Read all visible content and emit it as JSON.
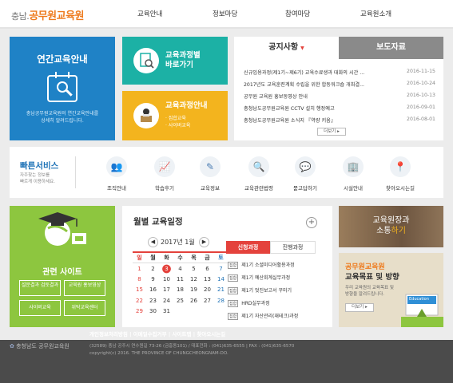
{
  "header": {
    "logo_prefix": "충남.",
    "logo_main": "공무원교육원",
    "nav": [
      "교육안내",
      "정보마당",
      "참여마당",
      "교육원소개"
    ]
  },
  "tiles": {
    "annual_title": "연간교육안내",
    "annual_desc1": "충남공무원교육원의 연간교육안내를",
    "annual_desc2": "상세히 알려드립니다.",
    "course_title1": "교육과정별",
    "course_title2": "바로가기",
    "guide_title": "교육과정안내",
    "guide_sub1": "· 집합교육",
    "guide_sub2": "· 사이버교육"
  },
  "notice": {
    "tab_notice": "공지사항",
    "tab_press": "보도자료",
    "items": [
      {
        "text": "신규임용과정(제1기~제6기) 교육수료생과 대화의 시간 ...",
        "date": "2016-11-15"
      },
      {
        "text": "2017년도 교육훈련계획 수립을 위한 합동워크숍 개최결...",
        "date": "2016-10-24"
      },
      {
        "text": "공무원 교육원 홍보동영상 안내",
        "date": "2016-10-13"
      },
      {
        "text": "충청남도공무원교육원 CCTV 설치 행정예고",
        "date": "2016-09-01"
      },
      {
        "text": "충청남도공무원교육원 소식지 『역량 키움』",
        "date": "2016-08-01"
      }
    ],
    "more": "더보기"
  },
  "quick": {
    "title": "빠른서비스",
    "sub1": "자주찾는 정보를",
    "sub2": "빠르게 이용하세요.",
    "items": [
      "조직안내",
      "학습후기",
      "교육정보",
      "교육관련법령",
      "묻고답하기",
      "시설안내",
      "찾아오시는길"
    ],
    "icons": [
      "people-icon",
      "chart-icon",
      "pencil-icon",
      "search-doc-icon",
      "chat-icon",
      "building-icon",
      "map-pin-icon"
    ]
  },
  "related": {
    "title": "관련 사이트",
    "buttons": [
      "설문결과 검토결과",
      "교육원 홍보영상",
      "사이버교육",
      "위탁교육센터"
    ]
  },
  "monthly": {
    "title": "월별 교육일정",
    "plus": "+",
    "month": "2017년 1월",
    "weekdays": [
      "일",
      "월",
      "화",
      "수",
      "목",
      "금",
      "토"
    ],
    "weeks": [
      [
        "1",
        "2",
        "3",
        "4",
        "5",
        "6",
        "7"
      ],
      [
        "8",
        "9",
        "10",
        "11",
        "12",
        "13",
        "14"
      ],
      [
        "15",
        "16",
        "17",
        "18",
        "19",
        "20",
        "21"
      ],
      [
        "22",
        "23",
        "24",
        "25",
        "26",
        "27",
        "28"
      ],
      [
        "29",
        "30",
        "31",
        "",
        "",
        "",
        ""
      ]
    ],
    "today": "3",
    "tab_apply": "신청과정",
    "tab_running": "진행과정",
    "courses": [
      {
        "tag": "집합",
        "name": "제1기 소셜미디어활용과정"
      },
      {
        "tag": "집합",
        "name": "제1기 예산회계실무과정"
      },
      {
        "tag": "집합",
        "name": "제1기 멋진보고서 꾸미기"
      },
      {
        "tag": "집합",
        "name": "HRD실무과정"
      },
      {
        "tag": "집합",
        "name": "제1기 자산관리(재테크)과정"
      }
    ]
  },
  "banners": {
    "b1_line1": "교육원장과",
    "b1_line2a": "소통",
    "b1_line2b": "하기",
    "b2_line1": "공무원교육원",
    "b2_line2": "교육목표 및 방향",
    "b2_desc1": "우리 교육원의 교육목표 및",
    "b2_desc2": "방향을 알려드립니다.",
    "b2_more": "더보기",
    "b2_img": "Education"
  },
  "footer": {
    "logo": "충청남도 공무원교육원",
    "links": [
      "개인정보처리방침",
      "이메일수집거부",
      "사이트맵",
      "찾아오시는길"
    ],
    "address": "(32589) 충남 공주시 연수원길 73-26 (금흥동101) / 대표전화 : (041)635-6555 | FAX : (041)635-6570",
    "copyright": "copyright(c) 2016. THE PROVINCE OF CHUNGCHEONGNAM-DO."
  },
  "colors": {
    "annual": "#1f82c6",
    "course": "#1cb1a5",
    "guide": "#f3b41e",
    "related": "#8dc63f",
    "accent": "#e4423c"
  }
}
